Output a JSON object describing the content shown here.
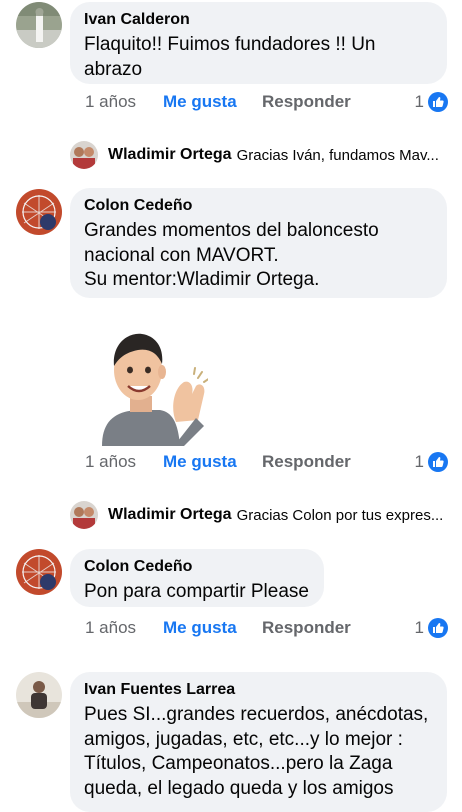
{
  "comments": [
    {
      "author": "Ivan Calderon",
      "text": "Flaquito!! Fuimos fundadores !! Un\nabrazo",
      "time": "1 años",
      "like_label": "Me gusta",
      "reply_label": "Responder",
      "reactions": "1"
    },
    {
      "author": "Colon Cedeño",
      "text": "Grandes momentos del baloncesto\nnacional con MAVORT.\nSu mentor:Wladimir Ortega.",
      "time": "1 años",
      "like_label": "Me gusta",
      "reply_label": "Responder",
      "reactions": "1"
    },
    {
      "author": "Colon Cedeño",
      "text": "Pon para compartir Please",
      "time": "1 años",
      "like_label": "Me gusta",
      "reply_label": "Responder",
      "reactions": "1"
    },
    {
      "author": "Ivan Fuentes Larrea",
      "text": "Pues SI...grandes recuerdos, anécdotas,\namigos, jugadas, etc, etc...y lo mejor :\nTítulos, Campeonatos...pero la Zaga\nqueda, el legado queda y los amigos"
    }
  ],
  "reply_previews": [
    {
      "author": "Wladimir Ortega",
      "text": "Gracias Iván, fundamos Mav..."
    },
    {
      "author": "Wladimir Ortega",
      "text": "Gracias Colon por tus expres..."
    }
  ],
  "icons": {
    "like_badge": "thumbs-up-icon",
    "sticker": "clapping-avatar-sticker"
  },
  "colors": {
    "bubble": "#f0f2f5",
    "like_blue": "#1877f2",
    "meta_gray": "#65676b"
  }
}
